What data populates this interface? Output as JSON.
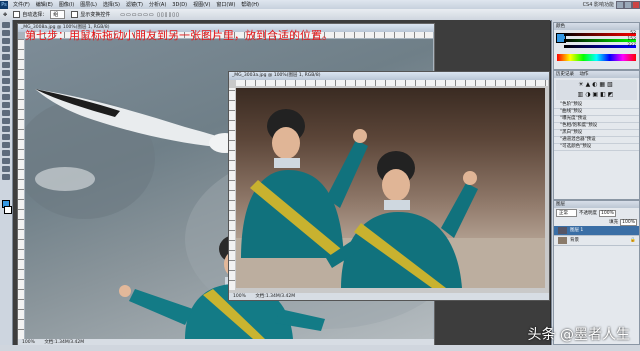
{
  "menubar": {
    "app_badge": "Ps",
    "items": [
      "文件(F)",
      "编辑(E)",
      "图像(I)",
      "图层(L)",
      "选择(S)",
      "滤镜(T)",
      "分析(A)",
      "3D(D)",
      "视图(V)",
      "窗口(W)",
      "帮助(H)"
    ],
    "mode": "CS4 影响功能"
  },
  "options": {
    "auto_select_label": "自动选择：",
    "auto_select_value": "组",
    "show_transform_label": "显示变换控件"
  },
  "doc1": {
    "title": "_MG_3008a.jpg @ 100%(图层 1, RGB/8)",
    "status_zoom": "100%",
    "status_doc": "文档:1.34M/3.42M"
  },
  "caption": "第七步：用鼠标拖动小朋友到另一张图片里，放到合适的位置。",
  "doc2": {
    "title": "_MG_3003a.jpg @ 100%(图层 1, RGB/8)",
    "status_zoom": "100%",
    "status_doc": "文档:1.34M/3.42M"
  },
  "color_panel": {
    "tab": "颜色",
    "r": "52",
    "g": "152",
    "b": "227"
  },
  "actions_panel": {
    "tabs": [
      "历史记录",
      "动作"
    ],
    "items": [
      "\"色阶\"预设",
      "\"曲线\"预设",
      "\"曝光度\"预设",
      "\"色相/饱和度\"预设",
      "\"黑白\"预设",
      "\"通道混合器\"预设",
      "\"可选颜色\"预设"
    ]
  },
  "layers_panel": {
    "tab": "图层",
    "blend_mode": "正常",
    "opacity_label": "不透明度",
    "opacity": "100%",
    "fill_label": "填充",
    "fill": "100%",
    "layers": [
      {
        "name": "图层 1",
        "selected": true
      },
      {
        "name": "背景",
        "selected": false
      }
    ]
  },
  "watermark": "头条 @墨者人生"
}
